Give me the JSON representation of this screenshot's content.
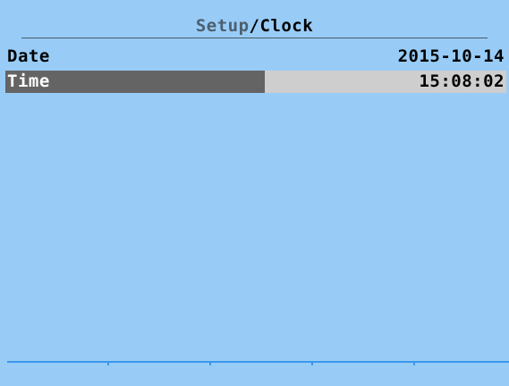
{
  "header": {
    "parent": "Setup",
    "separator": "/",
    "current": "Clock"
  },
  "rows": [
    {
      "label": "Date",
      "value": "2015-10-14",
      "selected": false
    },
    {
      "label": "Time",
      "value": "15:08:02",
      "selected": true
    }
  ],
  "colors": {
    "background": "#98ccf7",
    "selected_row": "#646464",
    "value_box": "#cecece",
    "footer_line": "#3a98ea"
  }
}
